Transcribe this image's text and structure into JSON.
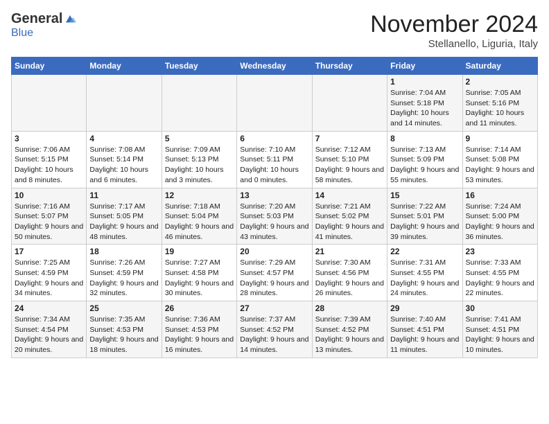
{
  "header": {
    "logo_general": "General",
    "logo_blue": "Blue",
    "month": "November 2024",
    "location": "Stellanello, Liguria, Italy"
  },
  "days_of_week": [
    "Sunday",
    "Monday",
    "Tuesday",
    "Wednesday",
    "Thursday",
    "Friday",
    "Saturday"
  ],
  "weeks": [
    [
      {
        "day": "",
        "info": ""
      },
      {
        "day": "",
        "info": ""
      },
      {
        "day": "",
        "info": ""
      },
      {
        "day": "",
        "info": ""
      },
      {
        "day": "",
        "info": ""
      },
      {
        "day": "1",
        "info": "Sunrise: 7:04 AM\nSunset: 5:18 PM\nDaylight: 10 hours and 14 minutes."
      },
      {
        "day": "2",
        "info": "Sunrise: 7:05 AM\nSunset: 5:16 PM\nDaylight: 10 hours and 11 minutes."
      }
    ],
    [
      {
        "day": "3",
        "info": "Sunrise: 7:06 AM\nSunset: 5:15 PM\nDaylight: 10 hours and 8 minutes."
      },
      {
        "day": "4",
        "info": "Sunrise: 7:08 AM\nSunset: 5:14 PM\nDaylight: 10 hours and 6 minutes."
      },
      {
        "day": "5",
        "info": "Sunrise: 7:09 AM\nSunset: 5:13 PM\nDaylight: 10 hours and 3 minutes."
      },
      {
        "day": "6",
        "info": "Sunrise: 7:10 AM\nSunset: 5:11 PM\nDaylight: 10 hours and 0 minutes."
      },
      {
        "day": "7",
        "info": "Sunrise: 7:12 AM\nSunset: 5:10 PM\nDaylight: 9 hours and 58 minutes."
      },
      {
        "day": "8",
        "info": "Sunrise: 7:13 AM\nSunset: 5:09 PM\nDaylight: 9 hours and 55 minutes."
      },
      {
        "day": "9",
        "info": "Sunrise: 7:14 AM\nSunset: 5:08 PM\nDaylight: 9 hours and 53 minutes."
      }
    ],
    [
      {
        "day": "10",
        "info": "Sunrise: 7:16 AM\nSunset: 5:07 PM\nDaylight: 9 hours and 50 minutes."
      },
      {
        "day": "11",
        "info": "Sunrise: 7:17 AM\nSunset: 5:05 PM\nDaylight: 9 hours and 48 minutes."
      },
      {
        "day": "12",
        "info": "Sunrise: 7:18 AM\nSunset: 5:04 PM\nDaylight: 9 hours and 46 minutes."
      },
      {
        "day": "13",
        "info": "Sunrise: 7:20 AM\nSunset: 5:03 PM\nDaylight: 9 hours and 43 minutes."
      },
      {
        "day": "14",
        "info": "Sunrise: 7:21 AM\nSunset: 5:02 PM\nDaylight: 9 hours and 41 minutes."
      },
      {
        "day": "15",
        "info": "Sunrise: 7:22 AM\nSunset: 5:01 PM\nDaylight: 9 hours and 39 minutes."
      },
      {
        "day": "16",
        "info": "Sunrise: 7:24 AM\nSunset: 5:00 PM\nDaylight: 9 hours and 36 minutes."
      }
    ],
    [
      {
        "day": "17",
        "info": "Sunrise: 7:25 AM\nSunset: 4:59 PM\nDaylight: 9 hours and 34 minutes."
      },
      {
        "day": "18",
        "info": "Sunrise: 7:26 AM\nSunset: 4:59 PM\nDaylight: 9 hours and 32 minutes."
      },
      {
        "day": "19",
        "info": "Sunrise: 7:27 AM\nSunset: 4:58 PM\nDaylight: 9 hours and 30 minutes."
      },
      {
        "day": "20",
        "info": "Sunrise: 7:29 AM\nSunset: 4:57 PM\nDaylight: 9 hours and 28 minutes."
      },
      {
        "day": "21",
        "info": "Sunrise: 7:30 AM\nSunset: 4:56 PM\nDaylight: 9 hours and 26 minutes."
      },
      {
        "day": "22",
        "info": "Sunrise: 7:31 AM\nSunset: 4:55 PM\nDaylight: 9 hours and 24 minutes."
      },
      {
        "day": "23",
        "info": "Sunrise: 7:33 AM\nSunset: 4:55 PM\nDaylight: 9 hours and 22 minutes."
      }
    ],
    [
      {
        "day": "24",
        "info": "Sunrise: 7:34 AM\nSunset: 4:54 PM\nDaylight: 9 hours and 20 minutes."
      },
      {
        "day": "25",
        "info": "Sunrise: 7:35 AM\nSunset: 4:53 PM\nDaylight: 9 hours and 18 minutes."
      },
      {
        "day": "26",
        "info": "Sunrise: 7:36 AM\nSunset: 4:53 PM\nDaylight: 9 hours and 16 minutes."
      },
      {
        "day": "27",
        "info": "Sunrise: 7:37 AM\nSunset: 4:52 PM\nDaylight: 9 hours and 14 minutes."
      },
      {
        "day": "28",
        "info": "Sunrise: 7:39 AM\nSunset: 4:52 PM\nDaylight: 9 hours and 13 minutes."
      },
      {
        "day": "29",
        "info": "Sunrise: 7:40 AM\nSunset: 4:51 PM\nDaylight: 9 hours and 11 minutes."
      },
      {
        "day": "30",
        "info": "Sunrise: 7:41 AM\nSunset: 4:51 PM\nDaylight: 9 hours and 10 minutes."
      }
    ]
  ]
}
